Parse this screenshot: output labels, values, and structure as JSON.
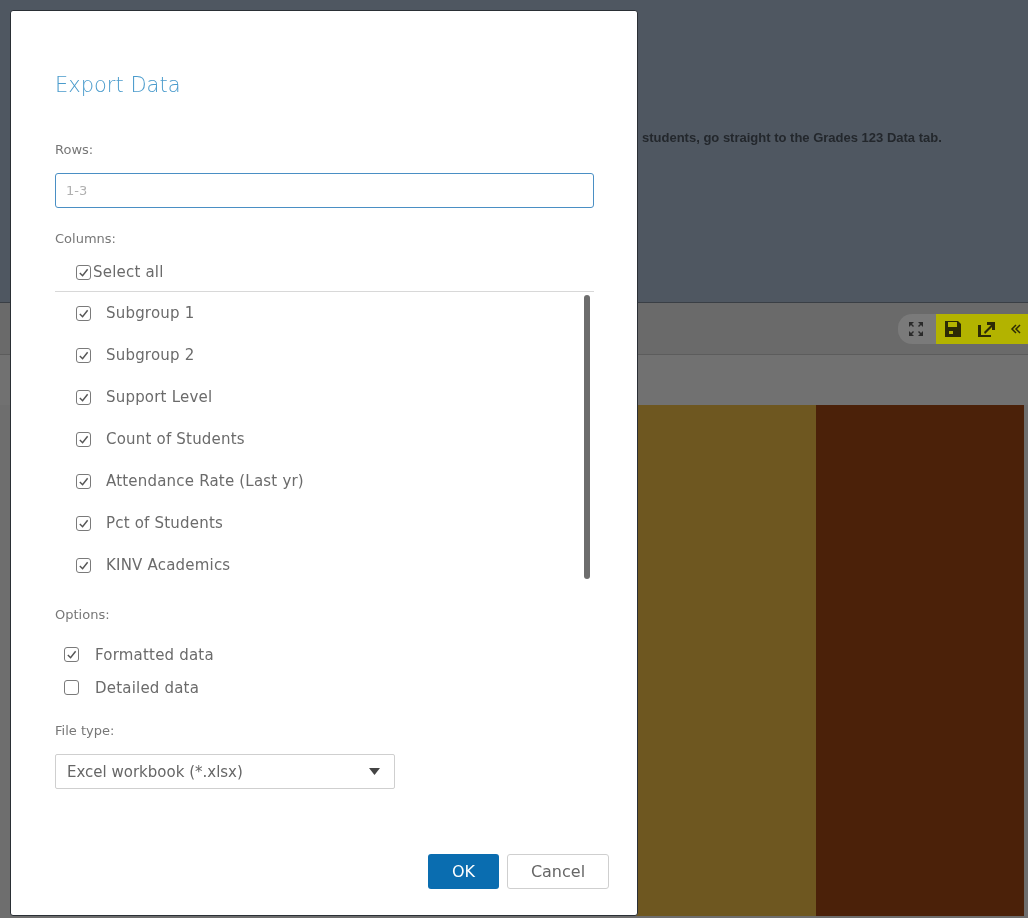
{
  "background": {
    "banner_text": "students, go straight to the Grades 123 Data tab.",
    "tiles": [
      {
        "color": "#6e5720"
      },
      {
        "color": "#4b2109"
      }
    ]
  },
  "dialog": {
    "title": "Export Data",
    "rows": {
      "label": "Rows:",
      "placeholder": "1-3"
    },
    "columns": {
      "label": "Columns:",
      "select_all": {
        "label": "Select all",
        "checked": true
      },
      "items": [
        {
          "label": "Subgroup 1",
          "checked": true
        },
        {
          "label": "Subgroup 2",
          "checked": true
        },
        {
          "label": "Support Level",
          "checked": true
        },
        {
          "label": "Count of Students",
          "checked": true
        },
        {
          "label": "Attendance Rate (Last yr)",
          "checked": true
        },
        {
          "label": "Pct of Students",
          "checked": true
        },
        {
          "label": "KINV Academics",
          "checked": true
        }
      ]
    },
    "options": {
      "label": "Options:",
      "items": [
        {
          "label": "Formatted data",
          "checked": true
        },
        {
          "label": "Detailed data",
          "checked": false
        }
      ]
    },
    "file_type": {
      "label": "File type:",
      "value": "Excel workbook (*.xlsx)"
    },
    "buttons": [
      {
        "label": "OK",
        "kind": "primary"
      },
      {
        "label": "Cancel",
        "kind": "secondary"
      }
    ]
  }
}
